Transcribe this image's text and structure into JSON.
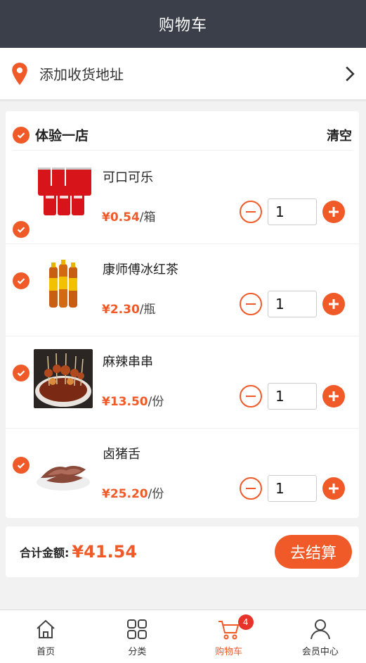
{
  "header": {
    "title": "购物车"
  },
  "address": {
    "label": "添加收货地址"
  },
  "store": {
    "name": "体验一店",
    "clear_label": "清空"
  },
  "items": [
    {
      "name": "可口可乐",
      "price": "¥0.54",
      "unit": "/箱",
      "qty": "1"
    },
    {
      "name": "康师傅冰红茶",
      "price": "¥2.30",
      "unit": "/瓶",
      "qty": "1"
    },
    {
      "name": "麻辣串串",
      "price": "¥13.50",
      "unit": "/份",
      "qty": "1"
    },
    {
      "name": "卤猪舌",
      "price": "¥25.20",
      "unit": "/份",
      "qty": "1"
    }
  ],
  "summary": {
    "total_label": "合计金额:",
    "total_value": "¥41.54",
    "checkout_label": "去结算"
  },
  "tabbar": {
    "tabs": [
      {
        "label": "首页",
        "icon": "home-icon"
      },
      {
        "label": "分类",
        "icon": "grid-icon"
      },
      {
        "label": "购物车",
        "icon": "cart-icon",
        "badge": "4",
        "active": true
      },
      {
        "label": "会员中心",
        "icon": "user-icon"
      }
    ]
  },
  "colors": {
    "accent": "#f05a28",
    "header_bg": "#3a3f4a",
    "badge": "#e8332a"
  }
}
